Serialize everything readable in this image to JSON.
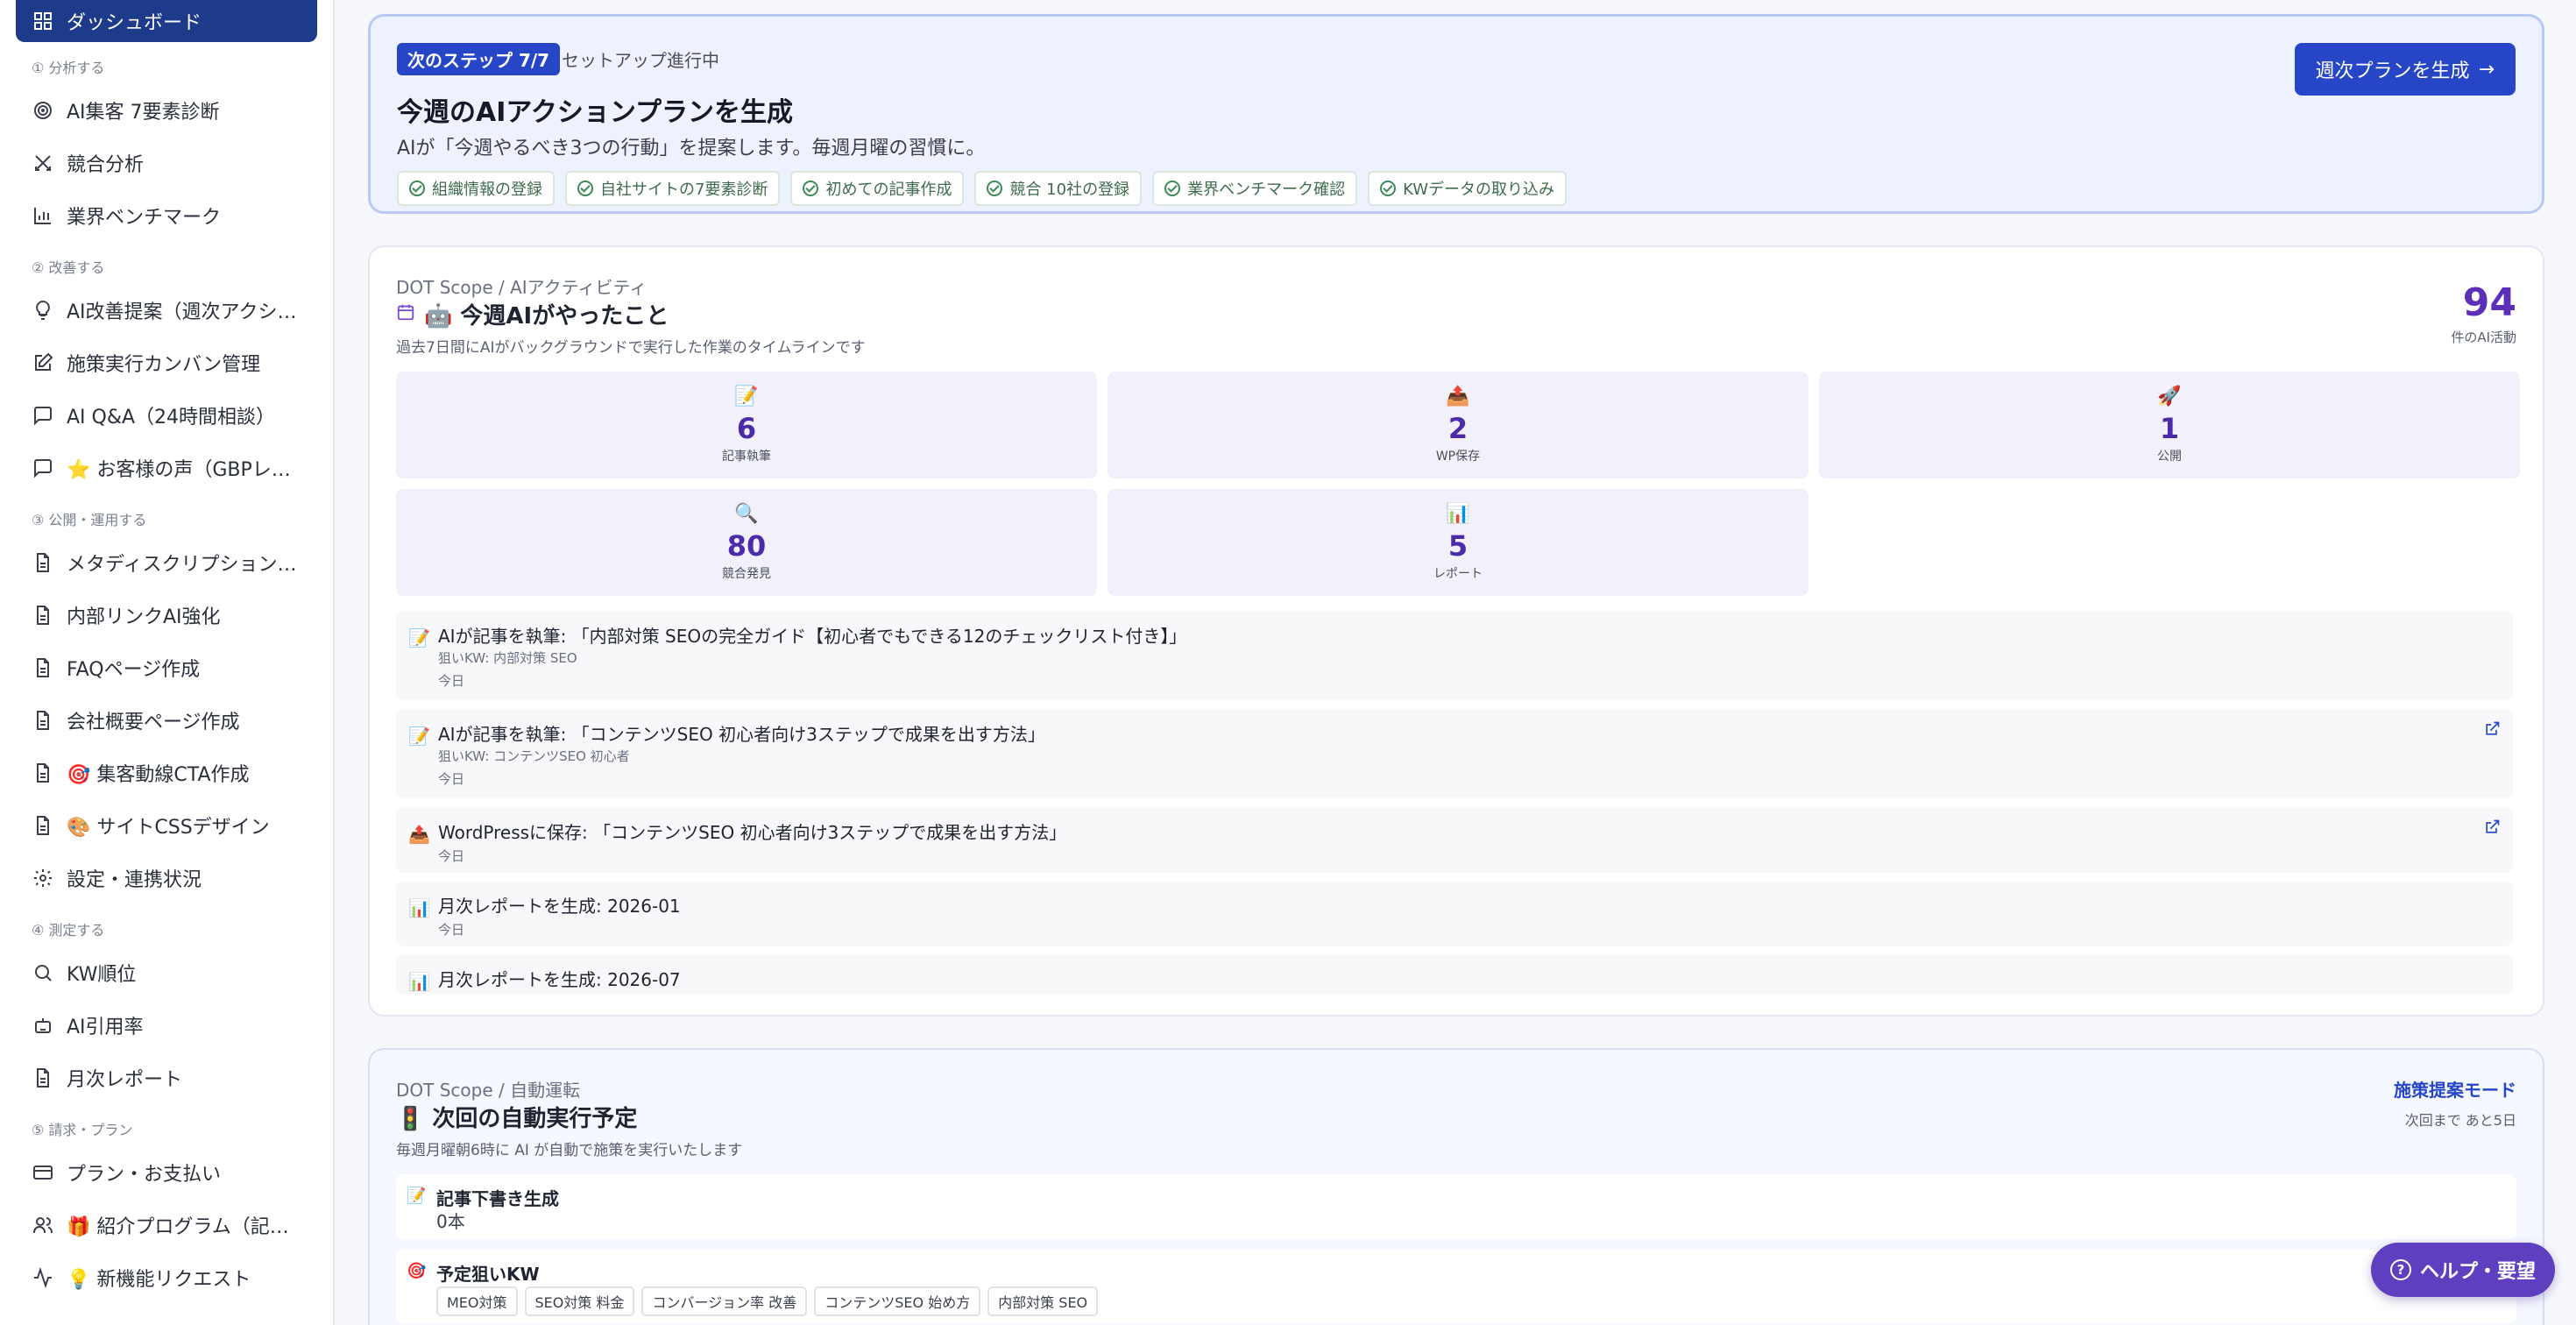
{
  "sidebar": {
    "dashboard": "ダッシュボード",
    "sec1": "① 分析する",
    "sec2": "② 改善する",
    "sec3": "③ 公開・運用する",
    "sec4": "④ 測定する",
    "sec5": "⑤ 請求・プラン",
    "items": {
      "diag": "AI集客 7要素診断",
      "competitor": "競合分析",
      "benchmark": "業界ベンチマーク",
      "suggest": "AI改善提案（週次アクショ…",
      "kanban": "施策実行カンバン管理",
      "qa": "AI Q&A（24時間相談）",
      "voice": "⭐ お客様の声（GBPレビ…",
      "meta": "メタディスクリプション最…",
      "link": "内部リンクAI強化",
      "faq": "FAQページ作成",
      "company": "会社概要ページ作成",
      "cta": "🎯 集客動線CTA作成",
      "css": "🎨 サイトCSSデザイン",
      "settings": "設定・連携状況",
      "kw": "KW順位",
      "cite": "AI引用率",
      "report": "月次レポート",
      "plan": "プラン・お支払い",
      "refer": "🎁 紹介プログラム（記事1…",
      "request": "💡 新機能リクエスト"
    }
  },
  "step": {
    "badge": "次のステップ 7/7",
    "status": "セットアップ進行中",
    "title": "今週のAIアクションプランを生成",
    "desc": "AIが「今週やるべき3つの行動」を提案します。毎週月曜の習慣に。",
    "button": "週次プランを生成",
    "chips": [
      "組織情報の登録",
      "自社サイトの7要素診断",
      "初めての記事作成",
      "競合 10社の登録",
      "業界ベンチマーク確認",
      "KWデータの取り込み"
    ]
  },
  "activity": {
    "crumb": "DOT Scope / AIアクティビティ",
    "title": "🤖 今週AIがやったこと",
    "sub": "過去7日間にAIがバックグラウンドで実行した作業のタイムラインです",
    "count": "94",
    "count_label": "件のAI活動",
    "stats": [
      {
        "emoji": "📝",
        "value": "6",
        "label": "記事執筆"
      },
      {
        "emoji": "📤",
        "value": "2",
        "label": "WP保存"
      },
      {
        "emoji": "🚀",
        "value": "1",
        "label": "公開"
      },
      {
        "emoji": "🔍",
        "value": "80",
        "label": "競合発見"
      },
      {
        "emoji": "📊",
        "value": "5",
        "label": "レポート"
      }
    ],
    "timeline": [
      {
        "emoji": "📝",
        "title": "AIが記事を執筆: 「内部対策 SEOの完全ガイド【初心者でもできる12のチェックリスト付き】」",
        "kw": "狙いKW: 内部対策 SEO",
        "date": "今日"
      },
      {
        "emoji": "📝",
        "title": "AIが記事を執筆: 「コンテンツSEO 初心者向け3ステップで成果を出す方法」",
        "kw": "狙いKW: コンテンツSEO 初心者",
        "date": "今日"
      },
      {
        "emoji": "📤",
        "title": "WordPressに保存: 「コンテンツSEO 初心者向け3ステップで成果を出す方法」",
        "date": "今日"
      },
      {
        "emoji": "📊",
        "title": "月次レポートを生成: 2026-01",
        "date": "今日"
      },
      {
        "emoji": "📊",
        "title": "月次レポートを生成: 2026-07"
      }
    ]
  },
  "auto": {
    "crumb": "DOT Scope / 自動運転",
    "title": "🚦 次回の自動実行予定",
    "sub": "毎週月曜朝6時に AI が自動で施策を実行いたします",
    "mode": "施策提案モード",
    "next": "次回まで あと5日",
    "draft_emoji": "📝",
    "draft_label": "記事下書き生成",
    "draft_value": "0本",
    "kw_emoji": "🎯",
    "kw_label": "予定狙いKW",
    "keywords": [
      "MEO対策",
      "SEO対策 料金",
      "コンバージョン率 改善",
      "コンテンツSEO 始め方",
      "内部対策 SEO"
    ]
  },
  "help": {
    "label": "ヘルプ・要望"
  }
}
